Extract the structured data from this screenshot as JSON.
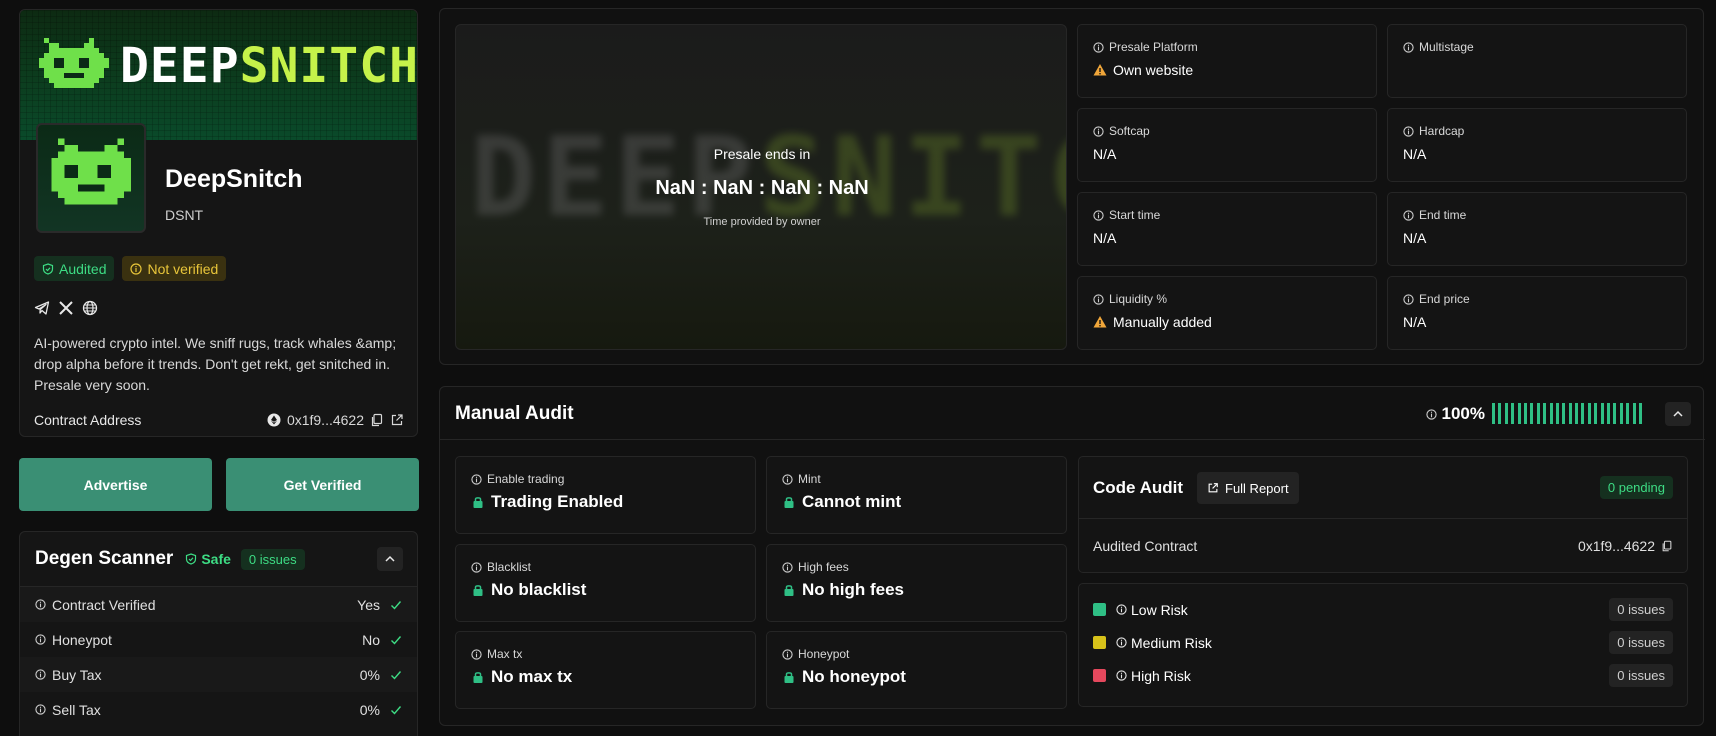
{
  "token": {
    "banner_word_white": "DEEP",
    "banner_word_green": "SNITCH",
    "name": "DeepSnitch",
    "symbol": "DSNT",
    "badges": {
      "audited": "Audited",
      "not_verified": "Not verified"
    },
    "description": "AI-powered crypto intel. We sniff rugs, track whales &amp; drop alpha before it trends. Don't get rekt, get snitched in. Presale very soon.",
    "contract_label": "Contract Address",
    "contract_value": "0x1f9...4622"
  },
  "actions": {
    "advertise": "Advertise",
    "get_verified": "Get Verified"
  },
  "scanner": {
    "title": "Degen Scanner",
    "safe_label": "Safe",
    "issues_label": "0 issues",
    "rows": [
      {
        "label": "Contract Verified",
        "value": "Yes"
      },
      {
        "label": "Honeypot",
        "value": "No"
      },
      {
        "label": "Buy Tax",
        "value": "0%"
      },
      {
        "label": "Sell Tax",
        "value": "0%"
      }
    ]
  },
  "presale": {
    "ends_label": "Presale ends in",
    "countdown": "NaN : NaN : NaN : NaN",
    "note": "Time provided by owner",
    "ghost_white": "DEEP",
    "ghost_green": "SNITCH",
    "cards": [
      {
        "label": "Presale Platform",
        "value": "Own website",
        "warn": true
      },
      {
        "label": "Multistage",
        "value": "",
        "warn": false
      },
      {
        "label": "Softcap",
        "value": "N/A",
        "warn": false
      },
      {
        "label": "Hardcap",
        "value": "N/A",
        "warn": false
      },
      {
        "label": "Start time",
        "value": "N/A",
        "warn": false
      },
      {
        "label": "End time",
        "value": "N/A",
        "warn": false
      },
      {
        "label": "Liquidity %",
        "value": "Manually added",
        "warn": true
      },
      {
        "label": "End price",
        "value": "N/A",
        "warn": false
      }
    ]
  },
  "manual_audit": {
    "title": "Manual Audit",
    "score": "100%",
    "score_fraction": 1.0,
    "checks": [
      {
        "label": "Enable trading",
        "value": "Trading Enabled"
      },
      {
        "label": "Mint",
        "value": "Cannot mint"
      },
      {
        "label": "Blacklist",
        "value": "No blacklist"
      },
      {
        "label": "High fees",
        "value": "No high fees"
      },
      {
        "label": "Max tx",
        "value": "No max tx"
      },
      {
        "label": "Honeypot",
        "value": "No honeypot"
      }
    ]
  },
  "code_audit": {
    "title": "Code Audit",
    "full_report": "Full Report",
    "pending": "0 pending",
    "audited_contract_label": "Audited Contract",
    "audited_contract_value": "0x1f9...4622",
    "risks": [
      {
        "label": "Low Risk",
        "issues": "0 issues",
        "color": "#2fbf85"
      },
      {
        "label": "Medium Risk",
        "issues": "0 issues",
        "color": "#d7c21a"
      },
      {
        "label": "High Risk",
        "issues": "0 issues",
        "color": "#e5485d"
      }
    ]
  },
  "colors": {
    "accent_green": "#3ddc84",
    "button_green": "#3a8f74",
    "warn": "#f0a63a"
  },
  "icons": [
    "info-icon",
    "warning-icon",
    "lock-icon",
    "shield-check-icon",
    "telegram-icon",
    "x-icon",
    "globe-icon",
    "copy-icon",
    "external-link-icon",
    "check-icon",
    "chevron-up-icon",
    "ethereum-icon"
  ]
}
